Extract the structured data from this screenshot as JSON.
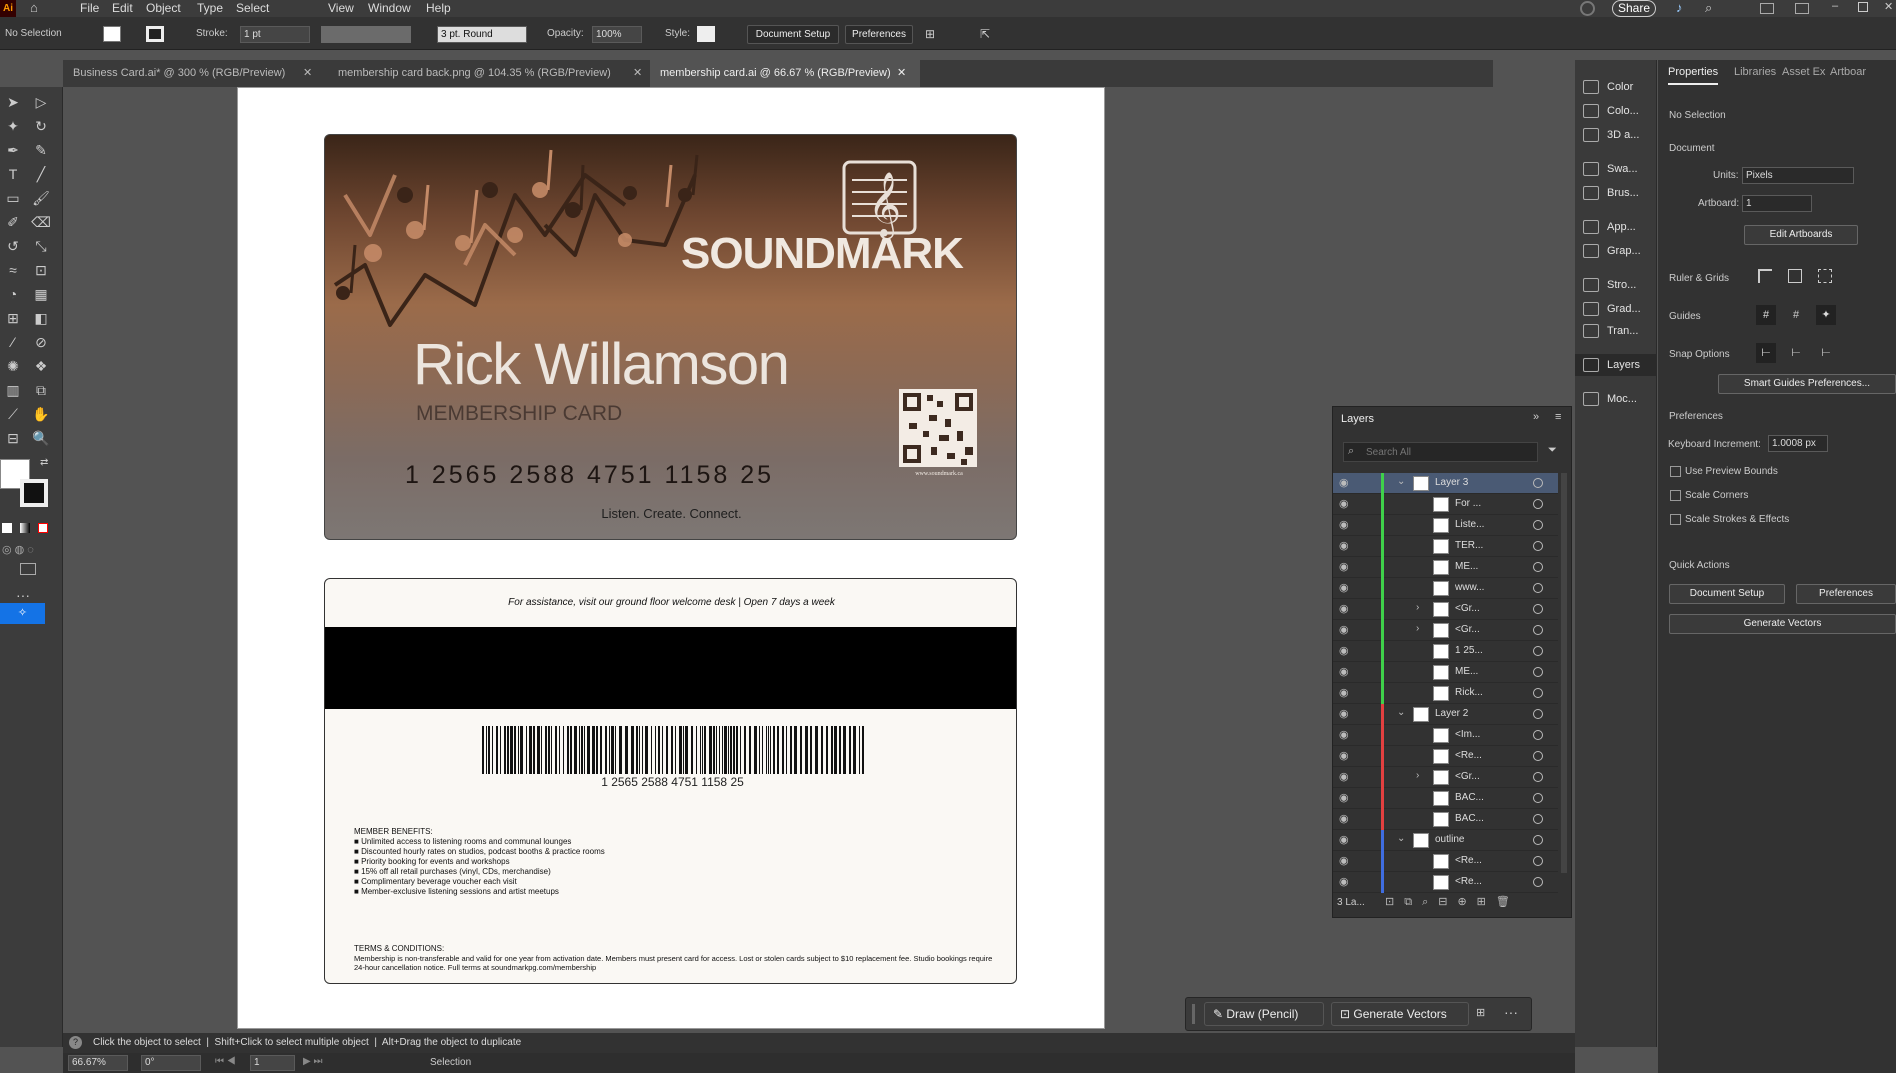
{
  "app": {
    "logo": "Ai",
    "menus": [
      "File",
      "Edit",
      "Object",
      "Type",
      "Select",
      "View",
      "Window",
      "Help"
    ],
    "share": "Share"
  },
  "control_bar": {
    "selection": "No Selection",
    "stroke_label": "Stroke:",
    "stroke_value": "1 pt",
    "brush": "3 pt. Round",
    "opacity_label": "Opacity:",
    "opacity_value": "100%",
    "style_label": "Style:",
    "document_setup": "Document Setup",
    "preferences": "Preferences"
  },
  "tabs": [
    {
      "label": "Business Card.ai* @ 300 % (RGB/Preview)"
    },
    {
      "label": "membership card back.png @ 104.35 % (RGB/Preview)"
    },
    {
      "label": "membership card.ai @ 66.67 % (RGB/Preview)"
    }
  ],
  "card_front": {
    "brand": "SOUNDMARK",
    "name": "Rick Willamson",
    "subtitle": "MEMBERSHIP CARD",
    "number": "1 2565 2588 4751 1158 25",
    "website": "www.soundmark.ca",
    "tagline": "Listen. Create. Connect."
  },
  "card_back": {
    "assistance": "For assistance, visit our ground floor welcome desk | Open 7 days a week",
    "barcode_number": "1 2565 2588 4751 1158 25",
    "benefits_title": "MEMBER BENEFITS:",
    "benefits": [
      "Unlimited access to listening rooms and communal lounges",
      "Discounted hourly rates on studios, podcast booths & practice rooms",
      "Priority booking for events and workshops",
      "15% off all retail purchases (vinyl, CDs, merchandise)",
      "Complimentary beverage voucher each visit",
      "Member-exclusive listening sessions and artist meetups"
    ],
    "terms_title": "TERMS & CONDITIONS:",
    "terms": "Membership is non-transferable and valid for one year from activation date. Members must present card for access. Lost or stolen cards subject to $10 replacement fee. Studio bookings require 24-hour cancellation notice. Full terms at soundmarkpg.com/membership"
  },
  "dock": [
    {
      "label": "Color",
      "icon": "color-icon"
    },
    {
      "label": "Colo...",
      "icon": "color-guide-icon"
    },
    {
      "label": "3D a...",
      "icon": "3d-icon"
    },
    {
      "label": "Swa...",
      "icon": "swatches-icon"
    },
    {
      "label": "Brus...",
      "icon": "brushes-icon"
    },
    {
      "label": "App...",
      "icon": "appearance-icon"
    },
    {
      "label": "Grap...",
      "icon": "graphic-styles-icon"
    },
    {
      "label": "Stro...",
      "icon": "stroke-icon"
    },
    {
      "label": "Grad...",
      "icon": "gradient-icon"
    },
    {
      "label": "Tran...",
      "icon": "transparency-icon"
    },
    {
      "label": "Layers",
      "icon": "layers-icon"
    },
    {
      "label": "Moc...",
      "icon": "mockup-icon"
    }
  ],
  "properties": {
    "tabs": [
      "Properties",
      "Libraries",
      "Asset Ex",
      "Artboar"
    ],
    "selection": "No Selection",
    "document": "Document",
    "units_label": "Units:",
    "units_value": "Pixels",
    "artboard_label": "Artboard:",
    "artboard_value": "1",
    "edit_artboards": "Edit Artboards",
    "ruler_grids": "Ruler & Grids",
    "guides": "Guides",
    "snap_options": "Snap Options",
    "smart_guides": "Smart Guides Preferences...",
    "preferences_title": "Preferences",
    "keyboard_increment_label": "Keyboard Increment:",
    "keyboard_increment_value": "1.0008 px",
    "use_preview_bounds": "Use Preview Bounds",
    "scale_corners": "Scale Corners",
    "scale_strokes": "Scale Strokes & Effects",
    "quick_actions": "Quick Actions",
    "document_setup": "Document Setup",
    "preferences_btn": "Preferences",
    "generate_vectors": "Generate Vectors"
  },
  "layers": {
    "title": "Layers",
    "search_placeholder": "Search All",
    "count": "3 La...",
    "rows": [
      {
        "name": "Layer 3",
        "color": "#3fd14a",
        "level": 0,
        "expanded": true
      },
      {
        "name": "For ...",
        "color": "#3fd14a",
        "level": 1
      },
      {
        "name": "Liste...",
        "color": "#3fd14a",
        "level": 1
      },
      {
        "name": "TER...",
        "color": "#3fd14a",
        "level": 1
      },
      {
        "name": "ME...",
        "color": "#3fd14a",
        "level": 1
      },
      {
        "name": "www...",
        "color": "#3fd14a",
        "level": 1
      },
      {
        "name": "<Gr...",
        "color": "#3fd14a",
        "level": 1,
        "arrow": true
      },
      {
        "name": "<Gr...",
        "color": "#3fd14a",
        "level": 1,
        "arrow": true
      },
      {
        "name": "1 25...",
        "color": "#3fd14a",
        "level": 1
      },
      {
        "name": "ME...",
        "color": "#3fd14a",
        "level": 1
      },
      {
        "name": "Rick...",
        "color": "#3fd14a",
        "level": 1
      },
      {
        "name": "Layer 2",
        "color": "#e34040",
        "level": 0,
        "expanded": true
      },
      {
        "name": "<Im...",
        "color": "#e34040",
        "level": 1
      },
      {
        "name": "<Re...",
        "color": "#e34040",
        "level": 1
      },
      {
        "name": "<Gr...",
        "color": "#e34040",
        "level": 1,
        "arrow": true
      },
      {
        "name": "BAC...",
        "color": "#e34040",
        "level": 1
      },
      {
        "name": "BAC...",
        "color": "#e34040",
        "level": 1
      },
      {
        "name": "outline",
        "color": "#3f6de0",
        "level": 0,
        "expanded": true
      },
      {
        "name": "<Re...",
        "color": "#3f6de0",
        "level": 1
      },
      {
        "name": "<Re...",
        "color": "#3f6de0",
        "level": 1
      }
    ]
  },
  "context_bar": {
    "draw": "Draw (Pencil)",
    "generate": "Generate Vectors"
  },
  "status": {
    "hint": "Click the object to select  |  Shift+Click to select multiple object  |  Alt+Drag the object to duplicate",
    "zoom": "66.67%",
    "rotation": "0°",
    "artboard": "1",
    "tool": "Selection"
  }
}
